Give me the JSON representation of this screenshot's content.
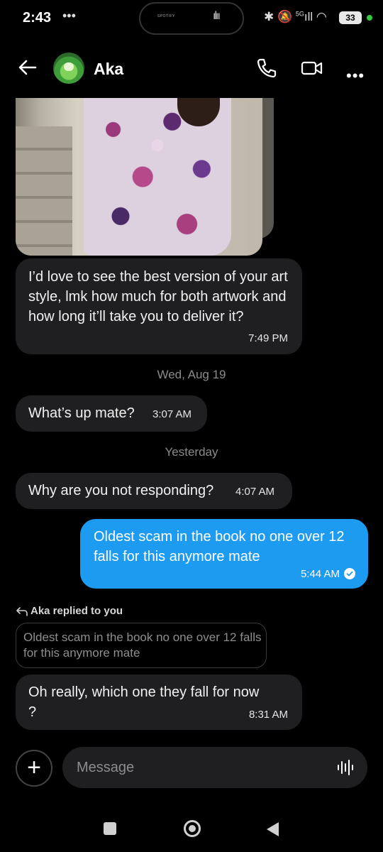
{
  "status_bar": {
    "time": "2:43",
    "extra": "•••",
    "island_label": "SPOTIFY",
    "signal_label": "5G",
    "battery": "33"
  },
  "header": {
    "contact_name": "Aka"
  },
  "messages": [
    {
      "text": "I’d love to see the best version of your art style, lmk how much for both artwork and how long it’ll take you to deliver it?",
      "time": "7:49 PM"
    },
    {
      "text": "What’s up mate?",
      "time": "3:07 AM"
    },
    {
      "text": "Why are you not responding?",
      "time": "4:07 AM"
    },
    {
      "text": "Oldest scam in the book no one over 12 falls for this anymore mate",
      "time": "5:44 AM"
    },
    {
      "text": "Oh really, which one they fall for now ?",
      "time": "8:31 AM"
    }
  ],
  "separators": {
    "first": "Wed, Aug 19",
    "second": "Yesterday"
  },
  "reply": {
    "label": "Aka replied to you",
    "quote": "Oldest scam in the book no one over 12 falls for this anymore mate"
  },
  "composer": {
    "placeholder": "Message"
  },
  "colors": {
    "background": "#000000",
    "incoming_bubble": "#1f1f21",
    "outgoing_bubble": "#1d9bf0"
  },
  "icons": [
    "back-arrow-icon",
    "phone-icon",
    "video-camera-icon",
    "more-icon",
    "plus-icon",
    "voice-icon",
    "read-check-icon",
    "reply-icon"
  ]
}
